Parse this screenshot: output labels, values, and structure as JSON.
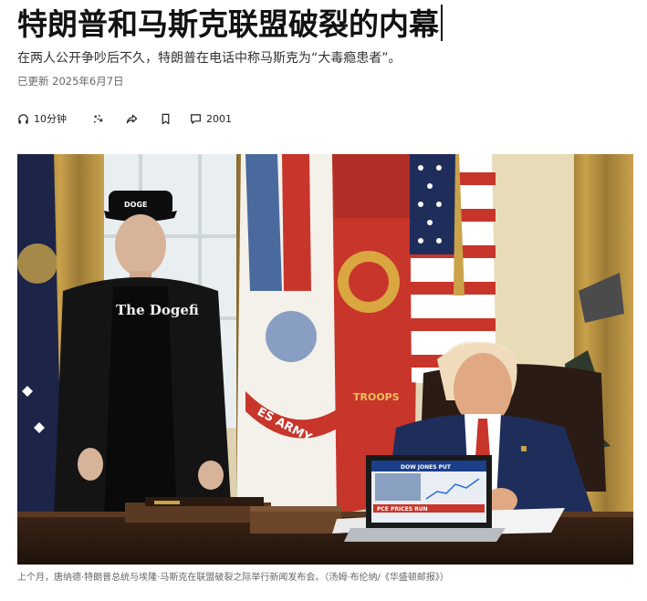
{
  "article": {
    "headline": "特朗普和马斯克联盟破裂的内幕",
    "dek": "在两人公开争吵后不久，特朗普在电话中称马斯克为“大毒瘾患者”。",
    "updated": "已更新 2025年6月7日"
  },
  "toolbar": {
    "listen_label": "10分钟",
    "comments_count": "2001",
    "icons": [
      "headphones-icon",
      "gift-icon",
      "share-icon",
      "bookmark-icon",
      "comment-icon"
    ]
  },
  "photo": {
    "shirt_text": "The Dogefi",
    "laptop_banner": "DOW JONES PUT",
    "laptop_ticker": "PCE PRICES RUN",
    "flag_text": "ES ARMY",
    "flag_text2": "TROOPS"
  },
  "caption": "上个月，唐纳德·特朗普总统与埃隆·马斯克在联盟破裂之际举行新闻发布会。（汤姆·布伦纳/《华盛顿邮报》）",
  "colors": {
    "text": "#121212",
    "muted": "#666666",
    "army_red": "#c8352b",
    "navy": "#1f2d5a",
    "gold": "#c9a24a"
  }
}
